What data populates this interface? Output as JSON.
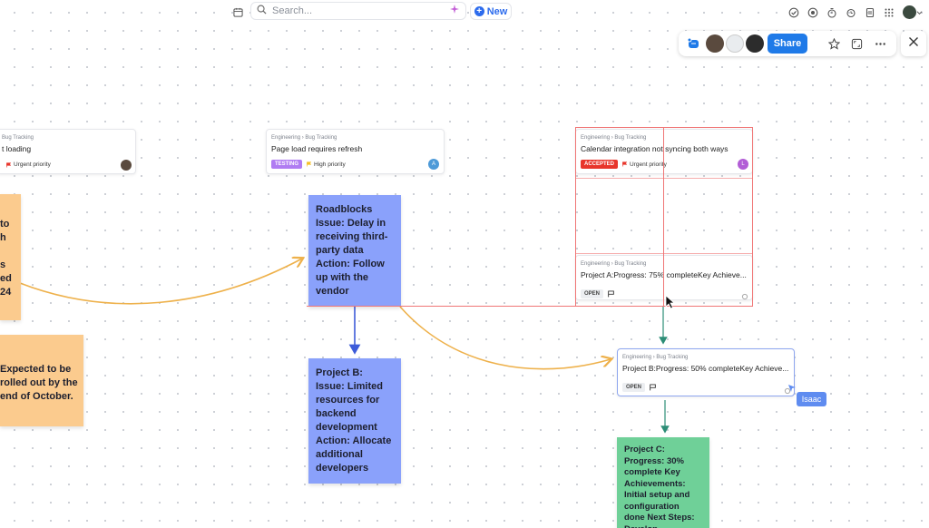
{
  "topbar": {
    "search_placeholder": "Search...",
    "new_label": "New"
  },
  "share_panel": {
    "share_label": "Share"
  },
  "cards": [
    {
      "crumb": "Bug Tracking",
      "title": "t loading",
      "priority": "Urgent priority"
    },
    {
      "crumb": "Engineering  ›  Bug Tracking",
      "title": "Page load requires refresh",
      "tag": "TESTING",
      "priority": "High priority",
      "assignee_initial": "A"
    },
    {
      "crumb": "Engineering  ›  Bug Tracking",
      "title": "Calendar integration not syncing both ways",
      "tag": "ACCEPTED",
      "priority": "Urgent priority",
      "assignee_initial": "L"
    },
    {
      "crumb": "Engineering  ›  Bug Tracking",
      "title": "Project A:Progress: 75% completeKey Achieve...",
      "tag": "OPEN"
    },
    {
      "crumb": "Engineering  ›  Bug Tracking",
      "title": "Project B:Progress: 50% completeKey Achieve...",
      "tag": "OPEN"
    }
  ],
  "notes": {
    "orange_left_lines": [
      "to",
      "h",
      "",
      "s",
      "ed",
      "24"
    ],
    "orange_bottom_lines": [
      "Expected to be",
      "rolled out by the",
      "end of October."
    ],
    "blue_roadblocks": "Roadblocks Issue: Delay in receiving third-party data Action: Follow up with the vendor",
    "blue_project_b": "Project B: Issue: Limited resources for backend development Action: Allocate additional developers",
    "green_project_c": "Project C: Progress: 30% complete Key Achievements: Initial setup and configuration done Next Steps: Develop"
  },
  "cursor": {
    "name": "Isaac"
  },
  "colors": {
    "accent": "#1f7ae8",
    "tag_testing": "#b07cf2",
    "tag_accepted": "#e8352b",
    "note_blue": "#8aa1fb",
    "note_orange": "#fbcb8e",
    "note_green": "#6fd098",
    "connector_orange": "#eeb14b",
    "connector_blue": "#3d5bd9",
    "connector_teal": "#2c8d76",
    "selection": "#f07676"
  }
}
